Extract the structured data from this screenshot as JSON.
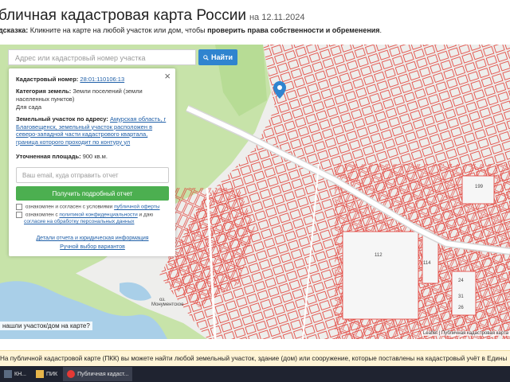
{
  "header": {
    "title": "бличная кадастровая карта России",
    "date": "на 12.11.2024",
    "hint_label": "дсказка:",
    "hint_text": "Кликните на карте на любой участок или дом, чтобы",
    "hint_bold": "проверить права собственности и обременения",
    "hint_end": "."
  },
  "search": {
    "placeholder": "Адрес или кадастровый номер участка",
    "button_label": "Найти"
  },
  "info_panel": {
    "cadastral_label": "Кадастровый номер:",
    "cadastral_value": "28:01:110106:13",
    "category_label": "Категория земель:",
    "category_value": "Земли поселений (земли населенных пунктов)",
    "usage_value": "Для сада",
    "address_label": "Земельный участок по адресу:",
    "address_value": "Амурская область, г Благовещенск, земельный участок расположен в северо-западной части кадастрового квартала, граница которого проходит по контуру ул",
    "area_label": "Уточненная площадь:",
    "area_value": "900 кв.м.",
    "email_placeholder": "Ваш email, куда отправить отчет",
    "report_button": "Получить подробный отчет",
    "offer_prefix": "ознакомлен и согласен с условиями",
    "offer_link": "публичной оферты",
    "privacy_prefix": "ознакомлен с",
    "privacy_link": "политикой конфиденциальности",
    "privacy_suffix": "и даю",
    "consent_link": "согласие на обработку персональных данных",
    "details_link": "Детали отчета и юридическая информация",
    "manual_link": "Ручной выбор вариантов"
  },
  "map": {
    "not_my_area": "нашли участок/дом на карте?",
    "attribution": "Leaflet | Публичная кадастровая карта",
    "labels": [
      "112",
      "114",
      "24",
      "199",
      "31",
      "26",
      "Монументское",
      "оз."
    ]
  },
  "notice": {
    "text": "На публичной кадастровой карте (ПКК) вы можете найти любой земельный участок, здание (дом) или сооружение, которые поставлены на кадастровый учёт в Едины"
  },
  "taskbar": {
    "items": [
      {
        "label": "КН..."
      },
      {
        "label": "ПИК"
      },
      {
        "label": "Публичная кадаст..."
      }
    ]
  },
  "colors": {
    "accent": "#2f84cf",
    "green_button": "#4caf50",
    "parcel_stroke": "#e0312f"
  }
}
